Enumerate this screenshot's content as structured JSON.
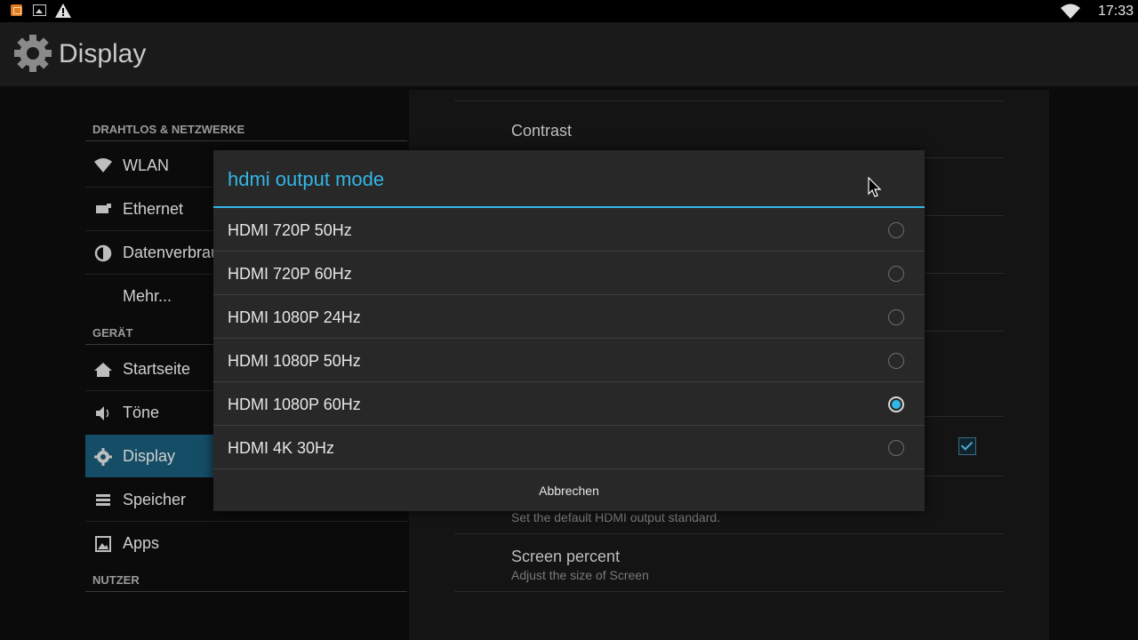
{
  "status_bar": {
    "time": "17:33",
    "icons": [
      "app-notification-icon",
      "image-icon",
      "warning-icon",
      "wifi-icon"
    ]
  },
  "action_bar": {
    "title": "Display",
    "icon": "gear-icon"
  },
  "sidebar": {
    "sections": [
      {
        "header": "DRAHTLOS & NETZWERKE"
      },
      {
        "header": "GERÄT"
      },
      {
        "header": "NUTZER"
      }
    ],
    "items": [
      {
        "label": "WLAN",
        "icon": "wifi-icon"
      },
      {
        "label": "Ethernet",
        "icon": "ethernet-icon"
      },
      {
        "label": "Datenverbrau",
        "icon": "data-usage-icon"
      },
      {
        "label": "Mehr...",
        "icon": ""
      },
      {
        "label": "Startseite",
        "icon": "home-icon"
      },
      {
        "label": "Töne",
        "icon": "sound-icon"
      },
      {
        "label": "Display",
        "icon": "gear-icon",
        "active": true
      },
      {
        "label": "Speicher",
        "icon": "storage-icon"
      },
      {
        "label": "Apps",
        "icon": "apps-icon"
      }
    ]
  },
  "detail": {
    "contrast_title": "Contrast",
    "hdmi_subtitle": "Set the default HDMI output standard.",
    "screen_percent_title": "Screen percent",
    "screen_percent_subtitle": "Adjust the size of Screen"
  },
  "dialog": {
    "title": "hdmi output mode",
    "options": [
      {
        "label": "HDMI 720P 50Hz",
        "selected": false
      },
      {
        "label": "HDMI 720P 60Hz",
        "selected": false
      },
      {
        "label": "HDMI 1080P 24Hz",
        "selected": false
      },
      {
        "label": "HDMI 1080P 50Hz",
        "selected": false
      },
      {
        "label": "HDMI 1080P 60Hz",
        "selected": true
      },
      {
        "label": "HDMI 4K 30Hz",
        "selected": false
      }
    ],
    "cancel_label": "Abbrechen"
  },
  "colors": {
    "accent": "#33b5e5",
    "active_item_bg": "#154d66",
    "dialog_bg": "#282828"
  }
}
